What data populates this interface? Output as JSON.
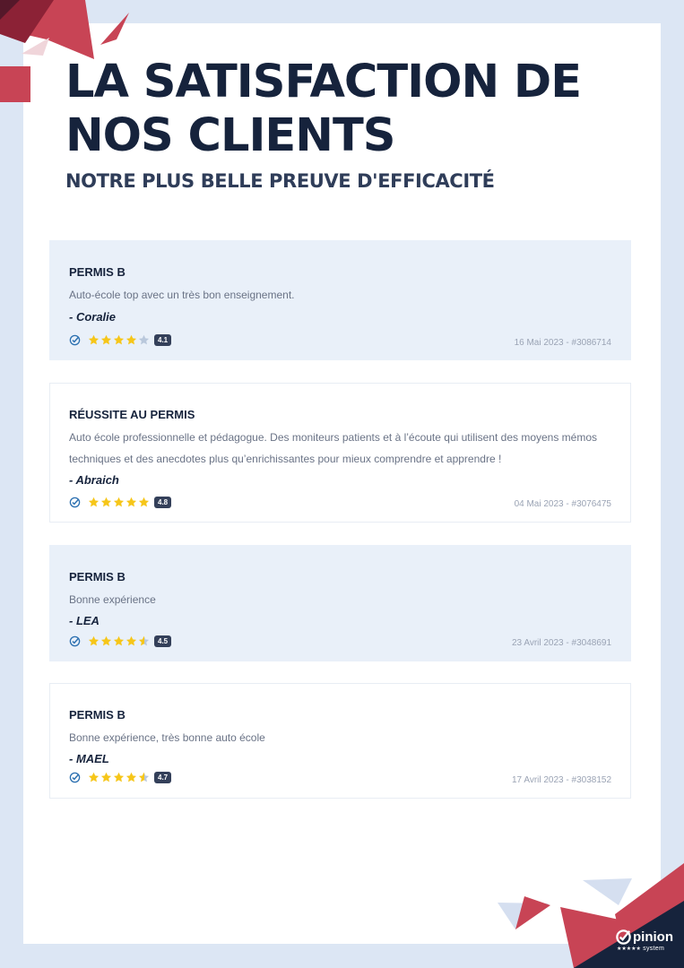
{
  "header": {
    "title": "LA SATISFACTION DE NOS CLIENTS",
    "subtitle": "NOTRE PLUS BELLE PREUVE D'EFFICACITÉ"
  },
  "colors": {
    "background": "#dce6f4",
    "title": "#16233c",
    "accent_red": "#c84455",
    "navy": "#16233c",
    "star": "#f6c619"
  },
  "reviews": [
    {
      "title": "PERMIS B",
      "text": "Auto-école top avec un très bon enseignement.",
      "author": "- Coralie",
      "rating": 4.1,
      "rating_label": "4.1",
      "meta": "16 Mai 2023 - #3086714"
    },
    {
      "title": "RÉUSSITE AU PERMIS",
      "text": "Auto école professionnelle et pédagogue. Des moniteurs patients et à l’écoute qui utilisent des moyens mémos techniques et des anecdotes plus qu’enrichissantes pour mieux comprendre et apprendre !",
      "author": "- Abraich",
      "rating": 4.8,
      "rating_label": "4.8",
      "meta": "04 Mai 2023 - #3076475"
    },
    {
      "title": "PERMIS B",
      "text": "Bonne expérience",
      "author": "- LEA",
      "rating": 4.5,
      "rating_label": "4.5",
      "meta": "23 Avril 2023 - #3048691"
    },
    {
      "title": "PERMIS B",
      "text": "Bonne expérience, très bonne auto école",
      "author": "- MAEL",
      "rating": 4.7,
      "rating_label": "4.7",
      "meta": "17 Avril 2023 - #3038152"
    }
  ],
  "brand": {
    "name": "pinion",
    "sub": "system",
    "icon": "opinion-check-icon"
  }
}
